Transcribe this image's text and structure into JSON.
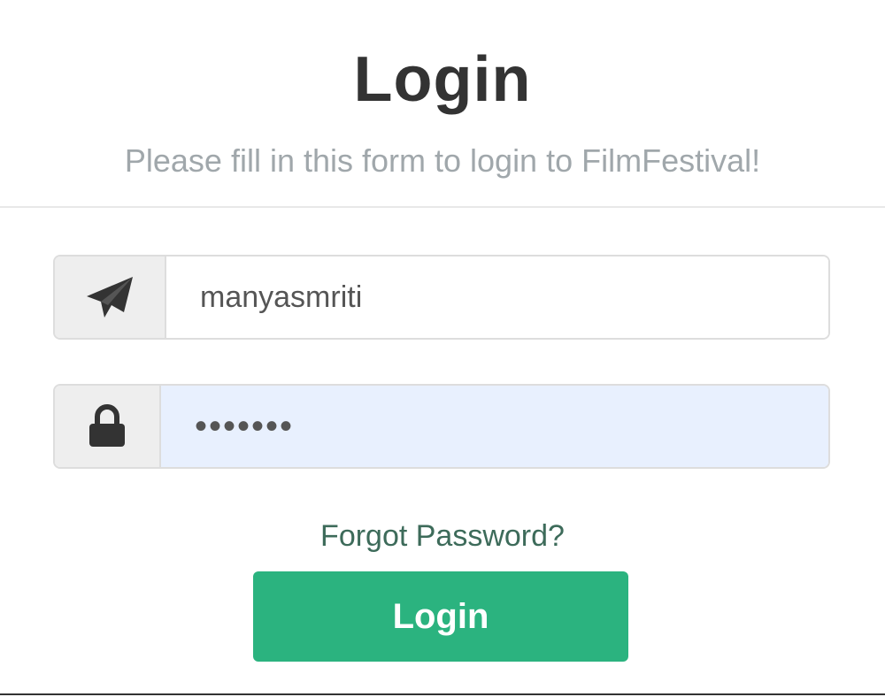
{
  "header": {
    "title": "Login",
    "subtitle": "Please fill in this form to login to FilmFestival!"
  },
  "form": {
    "username": {
      "icon": "paper-plane-icon",
      "value": "manyasmriti"
    },
    "password": {
      "icon": "lock-icon",
      "value": "•••••••"
    },
    "forgot_label": "Forgot Password?",
    "submit_label": "Login"
  },
  "colors": {
    "accent": "#2bb37f",
    "title": "#333333",
    "subtitle": "#a0a7ab",
    "link": "#3d6b5a",
    "autofill_bg": "#e8f0fe"
  }
}
